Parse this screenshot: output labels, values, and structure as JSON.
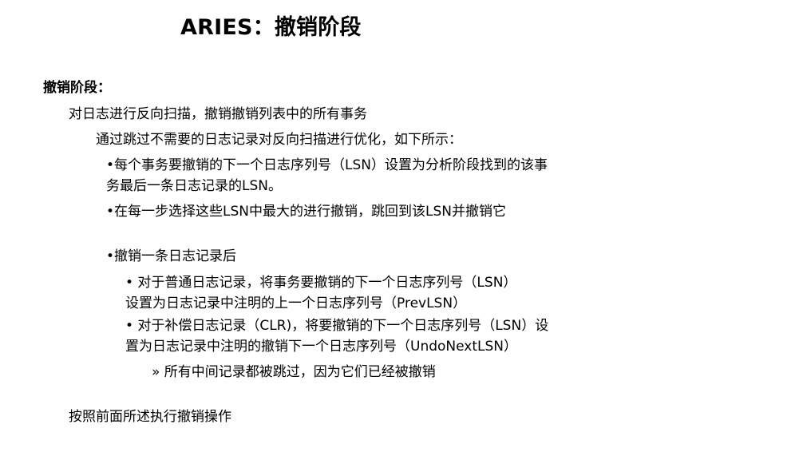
{
  "slide": {
    "title": "ARIES：撤销阶段",
    "section_heading": "撤销阶段：",
    "l1": "对日志进行反向扫描，撤销撤销列表中的所有事务",
    "l2": "通过跳过不需要的日志记录对反向扫描进行优化，如下所示：",
    "l3a": "•每个事务要撤销的下一个日志序列号（LSN）设置为分析阶段找到的该事",
    "l3b": "务最后一条日志记录的LSN。",
    "l4": "•在每一步选择这些LSN中最大的进行撤销，跳回到该LSN并撤销它",
    "l5": "•撤销一条日志记录后",
    "l6a": "• 对于普通日志记录，将事务要撤销的下一个日志序列号（LSN）",
    "l6b": "设置为日志记录中注明的上一个日志序列号（PrevLSN）",
    "l7a": "• 对于补偿日志记录（CLR)，将要撤销的下一个日志序列号（LSN）设",
    "l7b": "置为日志记录中注明的撤销下一个日志序列号（UndoNextLSN）",
    "l8": "» 所有中间记录都被跳过，因为它们已经被撤销",
    "l9": "按照前面所述执行撤销操作"
  }
}
